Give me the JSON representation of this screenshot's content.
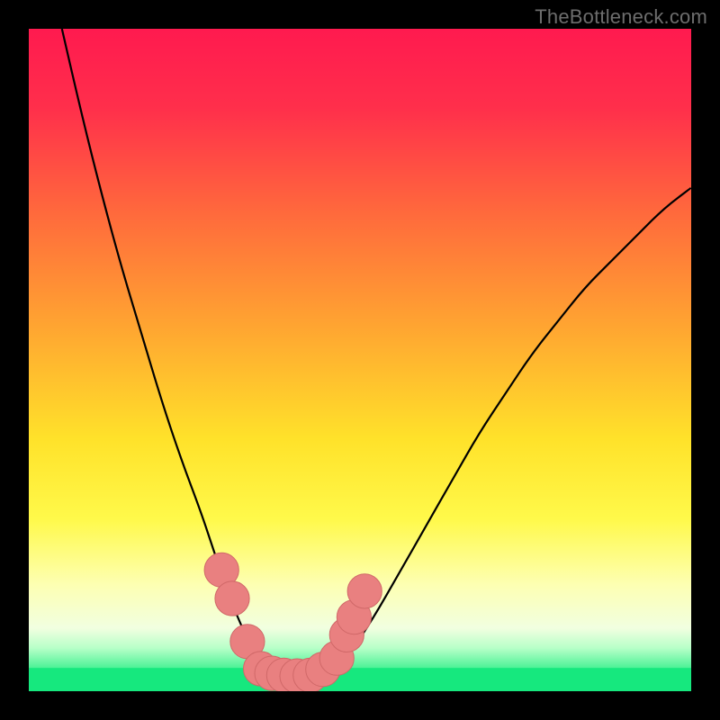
{
  "watermark": {
    "text": "TheBottleneck.com"
  },
  "colors": {
    "marker_fill": "#e98080",
    "marker_stroke": "#d06868",
    "curve_stroke": "#000000",
    "green_band": "#16e87e",
    "gradient_stops": [
      {
        "offset": 0.0,
        "color": "#ff1a4f"
      },
      {
        "offset": 0.12,
        "color": "#ff2f4b"
      },
      {
        "offset": 0.28,
        "color": "#ff6a3c"
      },
      {
        "offset": 0.45,
        "color": "#ffa531"
      },
      {
        "offset": 0.62,
        "color": "#ffe22a"
      },
      {
        "offset": 0.74,
        "color": "#fff94a"
      },
      {
        "offset": 0.84,
        "color": "#fdffb3"
      },
      {
        "offset": 0.905,
        "color": "#f1ffe0"
      },
      {
        "offset": 0.935,
        "color": "#b7ffc8"
      },
      {
        "offset": 0.965,
        "color": "#4cf296"
      },
      {
        "offset": 1.0,
        "color": "#16e87e"
      }
    ]
  },
  "chart_data": {
    "type": "line",
    "title": "",
    "xlabel": "",
    "ylabel": "",
    "xlim": [
      0,
      100
    ],
    "ylim": [
      0,
      100
    ],
    "grid": false,
    "legend": false,
    "series": [
      {
        "name": "bottleneck-curve",
        "x": [
          5,
          8,
          11,
          14,
          17,
          20,
          23,
          26,
          28,
          30,
          32,
          34,
          36,
          40,
          44,
          48,
          52,
          56,
          60,
          64,
          68,
          72,
          76,
          80,
          84,
          88,
          92,
          96,
          100
        ],
        "y": [
          100,
          87,
          75,
          64,
          54,
          44,
          35,
          27,
          21,
          15,
          10,
          6,
          3,
          0,
          1,
          5,
          11,
          18,
          25,
          32,
          39,
          45,
          51,
          56,
          61,
          65,
          69,
          73,
          76
        ]
      }
    ],
    "markers": [
      {
        "cx": 29.1,
        "cy": 18.3,
        "r": 2.6
      },
      {
        "cx": 30.7,
        "cy": 14.0,
        "r": 2.6
      },
      {
        "cx": 33.0,
        "cy": 7.5,
        "r": 2.6
      },
      {
        "cx": 35.0,
        "cy": 3.4,
        "r": 2.6
      },
      {
        "cx": 36.7,
        "cy": 2.7,
        "r": 2.6
      },
      {
        "cx": 38.5,
        "cy": 2.4,
        "r": 2.6
      },
      {
        "cx": 40.5,
        "cy": 2.3,
        "r": 2.6
      },
      {
        "cx": 42.5,
        "cy": 2.4,
        "r": 2.6
      },
      {
        "cx": 44.4,
        "cy": 3.3,
        "r": 2.6
      },
      {
        "cx": 46.5,
        "cy": 5.0,
        "r": 2.6
      },
      {
        "cx": 48.0,
        "cy": 8.5,
        "r": 2.6
      },
      {
        "cx": 49.1,
        "cy": 11.2,
        "r": 2.6
      },
      {
        "cx": 50.7,
        "cy": 15.1,
        "r": 2.6
      }
    ]
  }
}
